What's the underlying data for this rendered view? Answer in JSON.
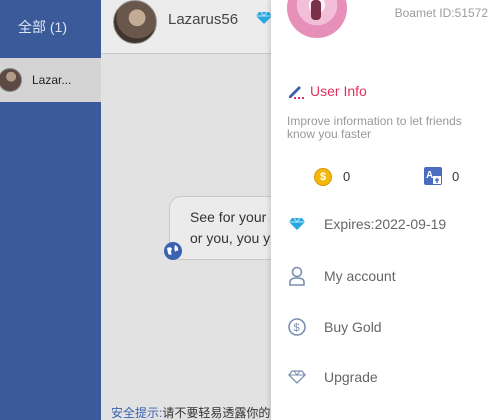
{
  "sidebar": {
    "tab_label": "全部 (1)",
    "conversations": [
      {
        "name": "Lazar..."
      }
    ]
  },
  "chat": {
    "contact_name": "Lazarus56",
    "message_visible_text": "See for your\nor you, you y",
    "safety_tip_label": "安全提示:",
    "safety_tip_text": "请不要轻易透露你的"
  },
  "drawer": {
    "user_id": "Boamet ID:51572",
    "user_info_label": "User Info",
    "user_info_hint": "Improve information to let friends know you faster",
    "gold_balance": "0",
    "translate_balance": "0",
    "expires": "Expires:2022-09-19",
    "menu": {
      "my_account": "My account",
      "buy_gold": "Buy Gold",
      "upgrade": "Upgrade"
    }
  },
  "colors": {
    "sidebar_bg": "#3a5a9a",
    "accent_pink": "#e0305e",
    "diamond_blue": "#29a8e0",
    "coin_gold": "#f2b80c",
    "link_blue": "#3a62b0"
  },
  "icons": [
    "diamond-icon",
    "globe-icon",
    "edit-icon",
    "gold-coin-icon",
    "translate-icon",
    "user-icon",
    "dollar-circle-icon"
  ]
}
